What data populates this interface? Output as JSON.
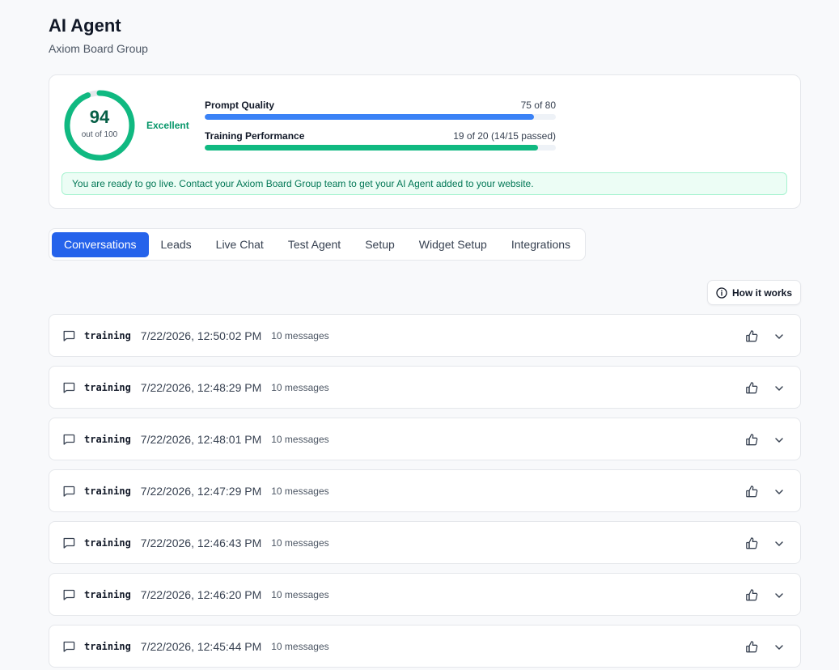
{
  "header": {
    "title": "AI Agent",
    "subtitle": "Axiom Board Group"
  },
  "score": {
    "value": "94",
    "caption": "out of 100",
    "fraction": 0.94,
    "rating": "Excellent",
    "metrics": [
      {
        "label": "Prompt Quality",
        "value": "75 of 80",
        "fraction": 0.9375,
        "color": "#3b82f6"
      },
      {
        "label": "Training Performance",
        "value": "19 of 20 (14/15 passed)",
        "fraction": 0.95,
        "color": "#10b981"
      }
    ],
    "banner": "You are ready to go live. Contact your Axiom Board Group team to get your AI Agent added to your website."
  },
  "tabs": [
    {
      "label": "Conversations",
      "active": true
    },
    {
      "label": "Leads",
      "active": false
    },
    {
      "label": "Live Chat",
      "active": false
    },
    {
      "label": "Test Agent",
      "active": false
    },
    {
      "label": "Setup",
      "active": false
    },
    {
      "label": "Widget Setup",
      "active": false
    },
    {
      "label": "Integrations",
      "active": false
    }
  ],
  "how_it_works": {
    "label": "How it works",
    "icon": "info-icon"
  },
  "conversations": [
    {
      "type": "training",
      "timestamp": "7/22/2026, 12:50:02 PM",
      "count": "10 messages"
    },
    {
      "type": "training",
      "timestamp": "7/22/2026, 12:48:29 PM",
      "count": "10 messages"
    },
    {
      "type": "training",
      "timestamp": "7/22/2026, 12:48:01 PM",
      "count": "10 messages"
    },
    {
      "type": "training",
      "timestamp": "7/22/2026, 12:47:29 PM",
      "count": "10 messages"
    },
    {
      "type": "training",
      "timestamp": "7/22/2026, 12:46:43 PM",
      "count": "10 messages"
    },
    {
      "type": "training",
      "timestamp": "7/22/2026, 12:46:20 PM",
      "count": "10 messages"
    },
    {
      "type": "training",
      "timestamp": "7/22/2026, 12:45:44 PM",
      "count": "10 messages"
    }
  ],
  "colors": {
    "accent": "#2563eb",
    "success": "#10b981",
    "success_dark": "#065f46"
  }
}
